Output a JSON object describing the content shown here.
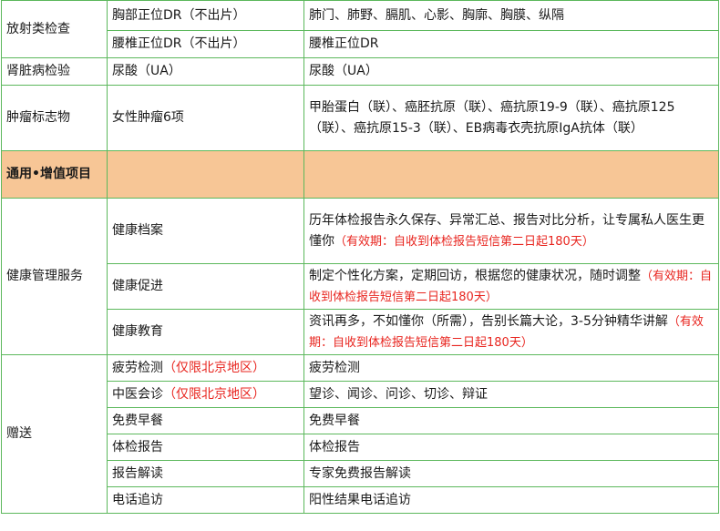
{
  "colors": {
    "border": "#5cb85c",
    "section_bg": "#f7c696",
    "note_red": "#e8251f"
  },
  "rows": {
    "r0": {
      "category": "放射类检查",
      "item": "胸部正位DR（不出片）",
      "desc": "肺门、肺野、膈肌、心影、胸廓、胸膜、纵隔"
    },
    "r1": {
      "item": "腰椎正位DR（不出片）",
      "desc": "腰椎正位DR"
    },
    "r2": {
      "category": "肾脏病检验",
      "item": "尿酸（UA）",
      "desc": "尿酸（UA）"
    },
    "r3": {
      "category": "肿瘤标志物",
      "item": "女性肿瘤6项",
      "desc": "甲胎蛋白（联）、癌胚抗原（联）、癌抗原19-9（联）、癌抗原125（联）、癌抗原15-3（联）、EB病毒衣壳抗原IgA抗体（联）"
    }
  },
  "section_title": "通用•增值项目",
  "health": {
    "category": "健康管理服务",
    "archive": {
      "item": "健康档案",
      "desc": "历年体检报告永久保存、异常汇总、报告对比分析，让专属私人医生更懂你",
      "note": "（有效期：自收到体检报告短信第二日起180天）"
    },
    "promote": {
      "item": "健康促进",
      "desc": "制定个性化方案，定期回访，根据您的健康状况，随时调整",
      "note": "（有效期：自收到体检报告短信第二日起180天）"
    },
    "education": {
      "item": "健康教育",
      "desc": "资讯再多，不如懂你（所需），告别长篇大论，3-5分钟精华讲解",
      "note": "（有效期：自收到体检报告短信第二日起180天）"
    }
  },
  "gift": {
    "category": "赠送",
    "items": [
      {
        "item": "疲劳检测",
        "note": "（仅限北京地区）",
        "desc": "疲劳检测"
      },
      {
        "item": "中医会诊",
        "note": "（仅限北京地区）",
        "desc": "望诊、闻诊、问诊、切诊、辩证"
      },
      {
        "item": "免费早餐",
        "desc": "免费早餐"
      },
      {
        "item": "体检报告",
        "desc": "体检报告"
      },
      {
        "item": "报告解读",
        "desc": "专家免费报告解读"
      },
      {
        "item": "电话追访",
        "desc": "阳性结果电话追访"
      }
    ]
  }
}
